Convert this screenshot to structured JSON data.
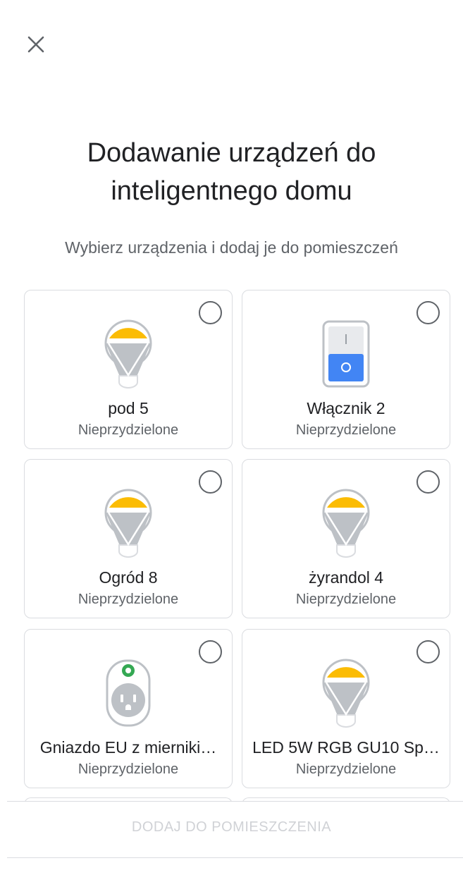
{
  "header": {
    "close_icon": "close-icon",
    "title_line1": "Dodawanie urządzeń do",
    "title_line2": "inteligentnego domu",
    "subtitle": "Wybierz urządzenia i dodaj je do pomieszczeń"
  },
  "devices": [
    {
      "name": "pod 5",
      "room": "Nieprzydzielone",
      "icon": "bulb-icon",
      "selected": false
    },
    {
      "name": "Włącznik 2",
      "room": "Nieprzydzielone",
      "icon": "switch-icon",
      "selected": false
    },
    {
      "name": "Ogród 8",
      "room": "Nieprzydzielone",
      "icon": "bulb-icon",
      "selected": false
    },
    {
      "name": "żyrandol 4",
      "room": "Nieprzydzielone",
      "icon": "bulb-icon",
      "selected": false
    },
    {
      "name": "Gniazdo EU z mierniki…",
      "room": "Nieprzydzielone",
      "icon": "outlet-icon",
      "selected": false
    },
    {
      "name": "LED 5W RGB GU10 Sp…",
      "room": "Nieprzydzielone",
      "icon": "bulb-icon",
      "selected": false
    }
  ],
  "footer": {
    "add_button_label": "DODAJ DO POMIESZCZENIA",
    "add_button_enabled": false
  },
  "colors": {
    "bulb_light": "#fbbc04",
    "bulb_body": "#bdc1c6",
    "switch_accent": "#4285f4",
    "outlet_led": "#34a853",
    "border": "#dadce0",
    "secondary_text": "#5f6368",
    "disabled_text": "#d0d2d6"
  }
}
